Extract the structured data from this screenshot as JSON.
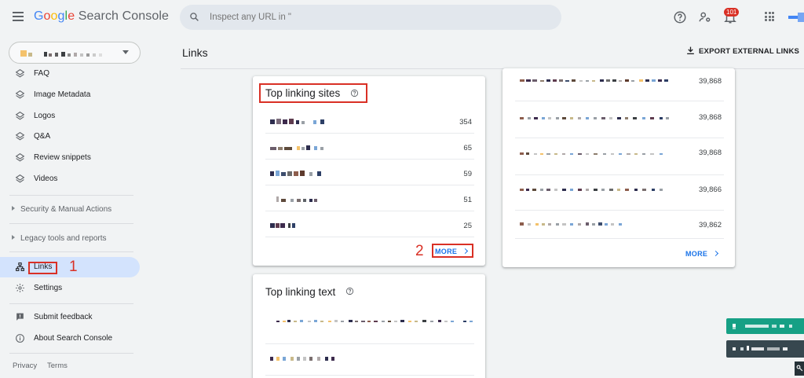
{
  "header": {
    "logo_letters": [
      "G",
      "o",
      "o",
      "g",
      "l",
      "e"
    ],
    "logo_rest": " Search Console",
    "search_placeholder": "Inspect any URL in \"",
    "notification_count": "101",
    "icons": [
      "menu-icon",
      "search-icon",
      "help-icon",
      "manage-users-icon",
      "notifications-icon",
      "apps-icon",
      "account-avatar"
    ]
  },
  "sidebar": {
    "items": [
      {
        "label": "FAQ",
        "icon": "enhancement-layers-icon"
      },
      {
        "label": "Image Metadata",
        "icon": "enhancement-layers-icon"
      },
      {
        "label": "Logos",
        "icon": "enhancement-layers-icon"
      },
      {
        "label": "Q&A",
        "icon": "enhancement-layers-icon"
      },
      {
        "label": "Review snippets",
        "icon": "enhancement-layers-icon"
      },
      {
        "label": "Videos",
        "icon": "enhancement-layers-icon"
      }
    ],
    "sections": [
      {
        "label": "Security & Manual Actions"
      },
      {
        "label": "Legacy tools and reports"
      }
    ],
    "links_label": "Links",
    "settings_label": "Settings",
    "submit_feedback_label": "Submit feedback",
    "about_label": "About Search Console",
    "footer": {
      "privacy": "Privacy",
      "terms": "Terms"
    }
  },
  "main": {
    "title": "Links",
    "export_label": "EXPORT EXTERNAL LINKS",
    "top_linking_sites": {
      "title": "Top linking sites",
      "rows": [
        {
          "value": "354"
        },
        {
          "value": "65"
        },
        {
          "value": "59"
        },
        {
          "value": "51"
        },
        {
          "value": "25"
        }
      ],
      "more_label": "MORE"
    },
    "top_linked_pages": {
      "rows": [
        {
          "value": "39,868"
        },
        {
          "value": "39,868"
        },
        {
          "value": "39,868"
        },
        {
          "value": "39,866"
        },
        {
          "value": "39,862"
        }
      ],
      "more_label": "MORE"
    },
    "top_linking_text": {
      "title": "Top linking text"
    }
  },
  "annotations": {
    "marker_1": "1",
    "marker_2": "2",
    "color": "#d93025"
  },
  "colors": {
    "accent": "#1a73e8",
    "active_nav": "#d3e3fd",
    "background": "#f1f3f4"
  }
}
